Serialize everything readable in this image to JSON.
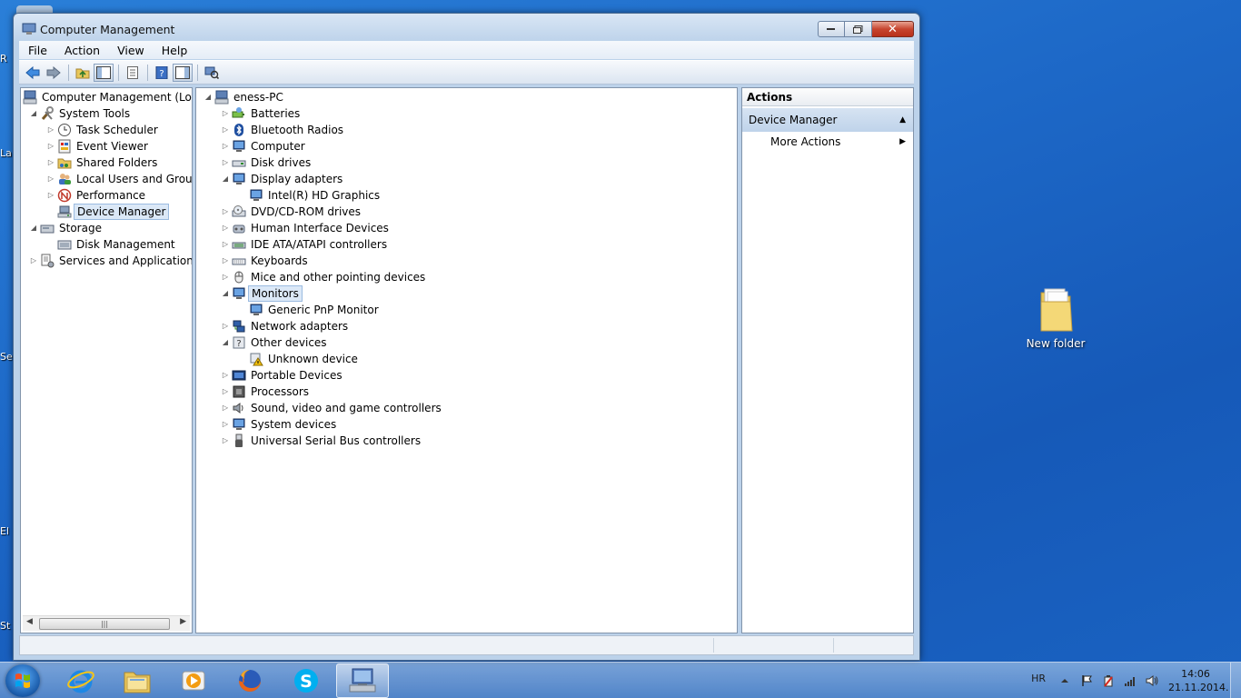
{
  "window": {
    "title": "Computer Management"
  },
  "menu": [
    "File",
    "Action",
    "View",
    "Help"
  ],
  "left_tree": [
    {
      "label": "Computer Management (Local",
      "level": 0,
      "expander": "",
      "icon": "computer-mgmt-icon"
    },
    {
      "label": "System Tools",
      "level": 1,
      "expander": "open",
      "icon": "system-tools-icon"
    },
    {
      "label": "Task Scheduler",
      "level": 2,
      "expander": "closed",
      "icon": "clock-icon"
    },
    {
      "label": "Event Viewer",
      "level": 2,
      "expander": "closed",
      "icon": "event-viewer-icon"
    },
    {
      "label": "Shared Folders",
      "level": 2,
      "expander": "closed",
      "icon": "shared-folder-icon"
    },
    {
      "label": "Local Users and Groups",
      "level": 2,
      "expander": "closed",
      "icon": "users-icon"
    },
    {
      "label": "Performance",
      "level": 2,
      "expander": "closed",
      "icon": "performance-icon"
    },
    {
      "label": "Device Manager",
      "level": 2,
      "expander": "",
      "icon": "device-manager-icon",
      "selected": true
    },
    {
      "label": "Storage",
      "level": 1,
      "expander": "open",
      "icon": "storage-icon"
    },
    {
      "label": "Disk Management",
      "level": 2,
      "expander": "",
      "icon": "disk-icon"
    },
    {
      "label": "Services and Applications",
      "level": 1,
      "expander": "closed",
      "icon": "services-icon"
    }
  ],
  "device_tree": [
    {
      "label": "eness-PC",
      "level": 0,
      "expander": "open",
      "icon": "computer-icon"
    },
    {
      "label": "Batteries",
      "level": 1,
      "expander": "closed",
      "icon": "battery-icon"
    },
    {
      "label": "Bluetooth Radios",
      "level": 1,
      "expander": "closed",
      "icon": "bluetooth-icon"
    },
    {
      "label": "Computer",
      "level": 1,
      "expander": "closed",
      "icon": "monitor-icon"
    },
    {
      "label": "Disk drives",
      "level": 1,
      "expander": "closed",
      "icon": "disk-drive-icon"
    },
    {
      "label": "Display adapters",
      "level": 1,
      "expander": "open",
      "icon": "display-adapter-icon"
    },
    {
      "label": "Intel(R) HD Graphics",
      "level": 2,
      "expander": "",
      "icon": "display-adapter-icon"
    },
    {
      "label": "DVD/CD-ROM drives",
      "level": 1,
      "expander": "closed",
      "icon": "dvd-icon"
    },
    {
      "label": "Human Interface Devices",
      "level": 1,
      "expander": "closed",
      "icon": "hid-icon"
    },
    {
      "label": "IDE ATA/ATAPI controllers",
      "level": 1,
      "expander": "closed",
      "icon": "ide-icon"
    },
    {
      "label": "Keyboards",
      "level": 1,
      "expander": "closed",
      "icon": "keyboard-icon"
    },
    {
      "label": "Mice and other pointing devices",
      "level": 1,
      "expander": "closed",
      "icon": "mouse-icon"
    },
    {
      "label": "Monitors",
      "level": 1,
      "expander": "open",
      "icon": "monitor-icon",
      "selected": true
    },
    {
      "label": "Generic PnP Monitor",
      "level": 2,
      "expander": "",
      "icon": "monitor-icon"
    },
    {
      "label": "Network adapters",
      "level": 1,
      "expander": "closed",
      "icon": "network-icon"
    },
    {
      "label": "Other devices",
      "level": 1,
      "expander": "open",
      "icon": "unknown-device-icon"
    },
    {
      "label": "Unknown device",
      "level": 2,
      "expander": "",
      "icon": "warning-device-icon"
    },
    {
      "label": "Portable Devices",
      "level": 1,
      "expander": "closed",
      "icon": "portable-device-icon"
    },
    {
      "label": "Processors",
      "level": 1,
      "expander": "closed",
      "icon": "processor-icon"
    },
    {
      "label": "Sound, video and game controllers",
      "level": 1,
      "expander": "closed",
      "icon": "sound-icon"
    },
    {
      "label": "System devices",
      "level": 1,
      "expander": "closed",
      "icon": "system-device-icon"
    },
    {
      "label": "Universal Serial Bus controllers",
      "level": 1,
      "expander": "closed",
      "icon": "usb-icon"
    }
  ],
  "actions": {
    "header": "Actions",
    "section": "Device Manager",
    "items": [
      "More Actions"
    ]
  },
  "desktop": {
    "folder_label": "New folder",
    "edge_labels": [
      "R",
      "La",
      "Se",
      "El",
      "St"
    ]
  },
  "taskbar": {
    "apps": [
      "internet-explorer-icon",
      "explorer-folder-icon",
      "media-player-icon",
      "firefox-icon",
      "skype-icon",
      "computer-management-icon"
    ],
    "active_app": "computer-management-icon",
    "language": "HR",
    "time": "14:06",
    "date": "21.11.2014."
  }
}
